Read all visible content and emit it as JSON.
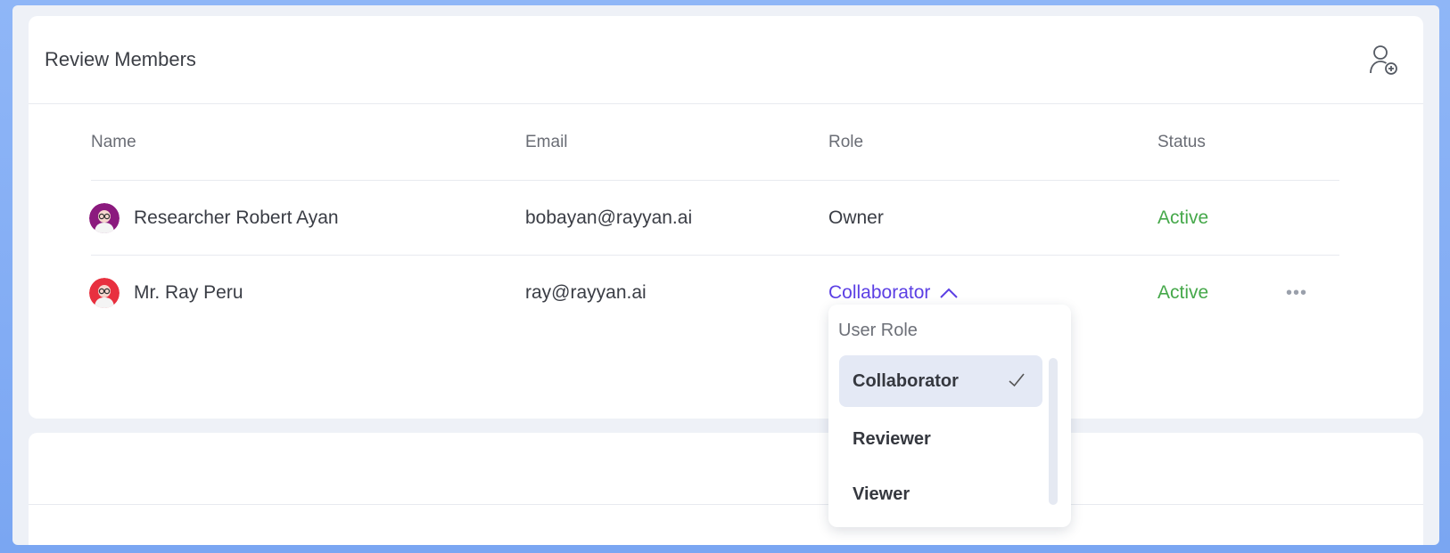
{
  "panel": {
    "title": "Review Members",
    "add_member_icon": "add-user-icon"
  },
  "table": {
    "columns": [
      "Name",
      "Email",
      "Role",
      "Status"
    ],
    "rows": [
      {
        "name": "Researcher Robert Ayan",
        "email": "bobayan@rayyan.ai",
        "role": "Owner",
        "status": "Active",
        "avatar_color": "#8b1a7e"
      },
      {
        "name": "Mr. Ray Peru",
        "email": "ray@rayyan.ai",
        "role": "Collaborator",
        "status": "Active",
        "avatar_color": "#e8303f",
        "more": "•••"
      }
    ]
  },
  "role_dropdown": {
    "title": "User Role",
    "options": [
      "Collaborator",
      "Reviewer",
      "Viewer"
    ],
    "selected": "Collaborator"
  },
  "colors": {
    "accent": "#5b3fe4",
    "status_active": "#45a84a"
  }
}
